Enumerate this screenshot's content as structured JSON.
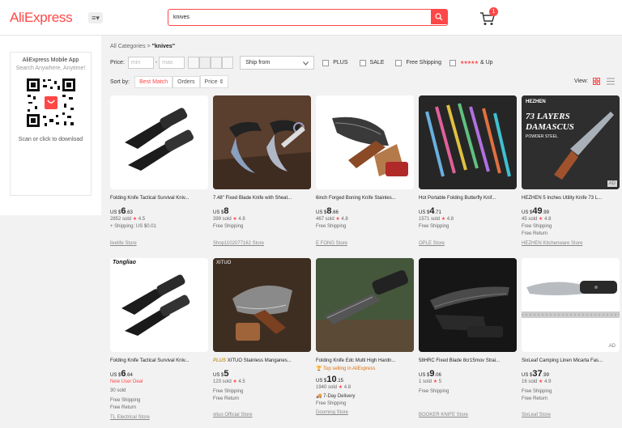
{
  "header": {
    "logo": "AliExpress",
    "category_menu": "≡▾",
    "search_value": "knives",
    "cart_count": "1"
  },
  "sidebar": {
    "title": "AliExpress Mobile App",
    "subtitle": "Search Anywhere, Anytime!",
    "footer": "Scan or click to download"
  },
  "breadcrumb": {
    "root": "All Categories",
    "sep": ">",
    "query": "\"knives\""
  },
  "filters": {
    "price_label": "Price:",
    "min_placeholder": "min",
    "max_placeholder": "max",
    "dash": "-",
    "ship_from": "Ship from",
    "plus": "PLUS",
    "sale": "SALE",
    "free_shipping": "Free Shipping",
    "rating_suffix": "& Up",
    "stars": "★★★★★"
  },
  "sort": {
    "label": "Sort by:",
    "options": [
      "Best Match",
      "Orders",
      "Price ⇕"
    ],
    "view_label": "View:"
  },
  "colors": {
    "accent": "#ff4747",
    "background": "#f2f2f2"
  },
  "products": [
    {
      "title": "Folding Knife Tactical Survival Kniv...",
      "currency": "US $",
      "price_int": "6",
      "price_dec": ".63",
      "sold": "2852 sold",
      "rating": "4.5",
      "lines": [
        "+ Shipping: US $0.01"
      ],
      "store": "livelife Store",
      "ad": "",
      "badge": "",
      "deal": "",
      "brand": ""
    },
    {
      "title": "7.48\" Fixed Blade Knife with Sheat...",
      "currency": "US $",
      "price_int": "8",
      "price_dec": "",
      "sold": "399 sold",
      "rating": "4.8",
      "lines": [
        "Free Shipping"
      ],
      "store": "Shop1102077162 Store",
      "ad": "",
      "badge": "",
      "deal": "",
      "brand": ""
    },
    {
      "title": "6inch Forged Boning Knife Stainles...",
      "currency": "US $",
      "price_int": "8",
      "price_dec": ".66",
      "sold": "467 sold",
      "rating": "4.8",
      "lines": [
        "Free Shipping"
      ],
      "store": "E FONG Store",
      "ad": "",
      "badge": "",
      "deal": "",
      "brand": ""
    },
    {
      "title": "Hot Portable Folding Butterfly Knif...",
      "currency": "US $",
      "price_int": "4",
      "price_dec": ".71",
      "sold": "1571 sold",
      "rating": "4.8",
      "lines": [
        "Free Shipping"
      ],
      "store": "OPLE Store",
      "ad": "",
      "badge": "",
      "deal": "",
      "brand": ""
    },
    {
      "title": "HEZHEN 5 Inches Utility Knife 73 L...",
      "currency": "US $",
      "price_int": "49",
      "price_dec": ".99",
      "sold": "45 sold",
      "rating": "4.8",
      "lines": [
        "Free Shipping",
        "Free Return"
      ],
      "store": "HEZHEN Kitchenware Store",
      "ad": "AD",
      "badge": "",
      "deal": "",
      "brand": "HEZHEN",
      "banner1": "73 LAYERS",
      "banner2": "DAMASCUS",
      "banner3": "POWDER STEEL"
    },
    {
      "title": "Folding Knife Tactical Survival Kniv...",
      "currency": "US $",
      "price_int": "6",
      "price_dec": ".64",
      "sold": "30 sold",
      "rating": "",
      "lines": [
        "Free Shipping",
        "Free Return"
      ],
      "store": "TL Electrical Store",
      "ad": "",
      "badge": "",
      "deal": "New User Deal",
      "brand": "Tongliao"
    },
    {
      "title": "XITUO Stainless Manganes...",
      "plus_tag": "PLUS",
      "currency": "US $",
      "price_int": "5",
      "price_dec": "",
      "sold": "123 sold",
      "rating": "4.5",
      "lines": [
        "Free Shipping",
        "Free Return"
      ],
      "store": "xituo Official Store",
      "ad": "",
      "badge": "",
      "deal": "",
      "brand": "XITUO"
    },
    {
      "title": "Folding Knife Edc Multi High Hardn...",
      "currency": "US $",
      "price_int": "10",
      "price_dec": ".15",
      "sold": "1940 sold",
      "rating": "4.8",
      "lines": [
        "7-Day Delivery",
        "Free Shipping"
      ],
      "store": "Dooming Store",
      "ad": "",
      "badge": "Top selling in AliExpress",
      "deal": "",
      "brand": ""
    },
    {
      "title": "58HRC Fixed Blade 8cr15mov Strai...",
      "currency": "US $",
      "price_int": "9",
      "price_dec": ".06",
      "sold": "1 sold",
      "rating": "5",
      "lines": [
        "Free Shipping"
      ],
      "store": "BOOKER KNIFE Store",
      "ad": "",
      "badge": "",
      "deal": "",
      "brand": ""
    },
    {
      "title": "SixLeaf Camping Linen Micarta Fas...",
      "currency": "US $",
      "price_int": "37",
      "price_dec": ".99",
      "sold": "16 sold",
      "rating": "4.9",
      "lines": [
        "Free Shipping",
        "Free Return"
      ],
      "store": "SixLeaf Store",
      "ad": "AD",
      "badge": "",
      "deal": "",
      "brand": ""
    }
  ]
}
